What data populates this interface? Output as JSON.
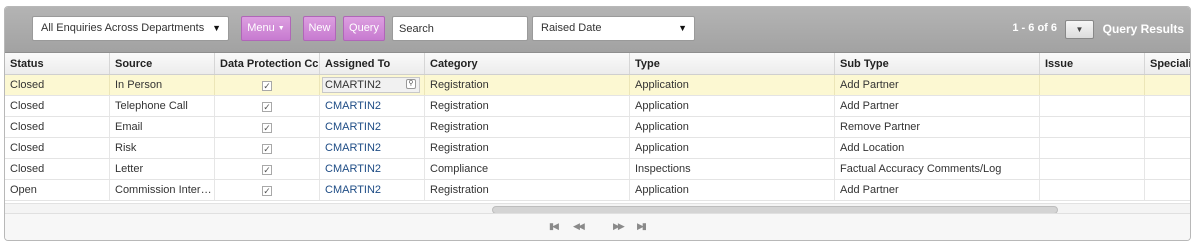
{
  "toolbar": {
    "view_select": "All Enquiries Across Departments",
    "menu_label": "Menu",
    "new_label": "New",
    "query_label": "Query",
    "search_placeholder": "Search",
    "date_select": "Raised Date",
    "pager": "1 - 6 of 6",
    "query_results_label": "Query Results"
  },
  "columns": [
    "Status",
    "Source",
    "Data Protection Cc",
    "Assigned To",
    "Category",
    "Type",
    "Sub Type",
    "Issue",
    "Speciali"
  ],
  "rows": [
    {
      "status": "Closed",
      "source": "In Person",
      "data_protection": true,
      "assigned_to": "CMARTIN2",
      "category": "Registration",
      "type": "Application",
      "sub_type": "Add Partner",
      "issue": "",
      "specialism": ""
    },
    {
      "status": "Closed",
      "source": "Telephone Call",
      "data_protection": true,
      "assigned_to": "CMARTIN2",
      "category": "Registration",
      "type": "Application",
      "sub_type": "Add Partner",
      "issue": "",
      "specialism": ""
    },
    {
      "status": "Closed",
      "source": "Email",
      "data_protection": true,
      "assigned_to": "CMARTIN2",
      "category": "Registration",
      "type": "Application",
      "sub_type": "Remove Partner",
      "issue": "",
      "specialism": ""
    },
    {
      "status": "Closed",
      "source": "Risk",
      "data_protection": true,
      "assigned_to": "CMARTIN2",
      "category": "Registration",
      "type": "Application",
      "sub_type": "Add Location",
      "issue": "",
      "specialism": ""
    },
    {
      "status": "Closed",
      "source": "Letter",
      "data_protection": true,
      "assigned_to": "CMARTIN2",
      "category": "Compliance",
      "type": "Inspections",
      "sub_type": "Factual Accuracy Comments/Log",
      "issue": "",
      "specialism": ""
    },
    {
      "status": "Open",
      "source": "Commission Inter…",
      "data_protection": true,
      "assigned_to": "CMARTIN2",
      "category": "Registration",
      "type": "Application",
      "sub_type": "Add Partner",
      "issue": "",
      "specialism": ""
    }
  ],
  "selected_row": 0,
  "icons": {
    "checkbox": "checkbox-checked-icon",
    "lookup": "lookup-icon",
    "nav_first": "first-page-icon",
    "nav_prev": "previous-page-icon",
    "nav_next": "next-page-icon",
    "nav_last": "last-page-icon"
  },
  "colors": {
    "toolbar_bg": "#a9a9a9",
    "button_purple": "#c77ad0",
    "selected_row": "#fcf8d2",
    "link": "#1e4c85"
  }
}
